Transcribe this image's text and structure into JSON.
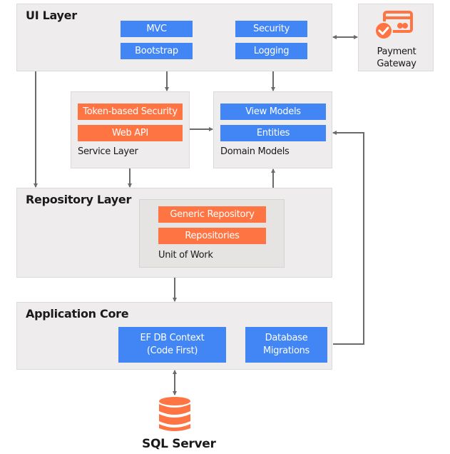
{
  "diagram": {
    "ui_layer": {
      "title": "UI Layer",
      "components": [
        "MVC",
        "Bootstrap",
        "Security",
        "Logging"
      ]
    },
    "payment_gateway": {
      "icon": "credit-card-check-icon",
      "label_line1": "Payment",
      "label_line2": "Gateway"
    },
    "service_layer": {
      "label": "Service Layer",
      "components": [
        "Token-based Security",
        "Web API"
      ]
    },
    "domain_models": {
      "label": "Domain Models",
      "components": [
        "View Models",
        "Entities"
      ]
    },
    "repository_layer": {
      "title": "Repository Layer",
      "unit_of_work": {
        "label": "Unit of Work",
        "components": [
          "Generic Repository",
          "Repositories"
        ]
      }
    },
    "application_core": {
      "title": "Application Core",
      "components": [
        {
          "line1": "EF DB Context",
          "line2": "(Code First)"
        },
        {
          "line1": "Database",
          "line2": "Migrations"
        }
      ]
    },
    "database": {
      "icon": "database-icon",
      "label": "SQL Server"
    },
    "colors": {
      "blue": "#4285f4",
      "orange": "#ff7443",
      "panel": "#eeecec",
      "arrow": "#6b6b6b"
    }
  }
}
